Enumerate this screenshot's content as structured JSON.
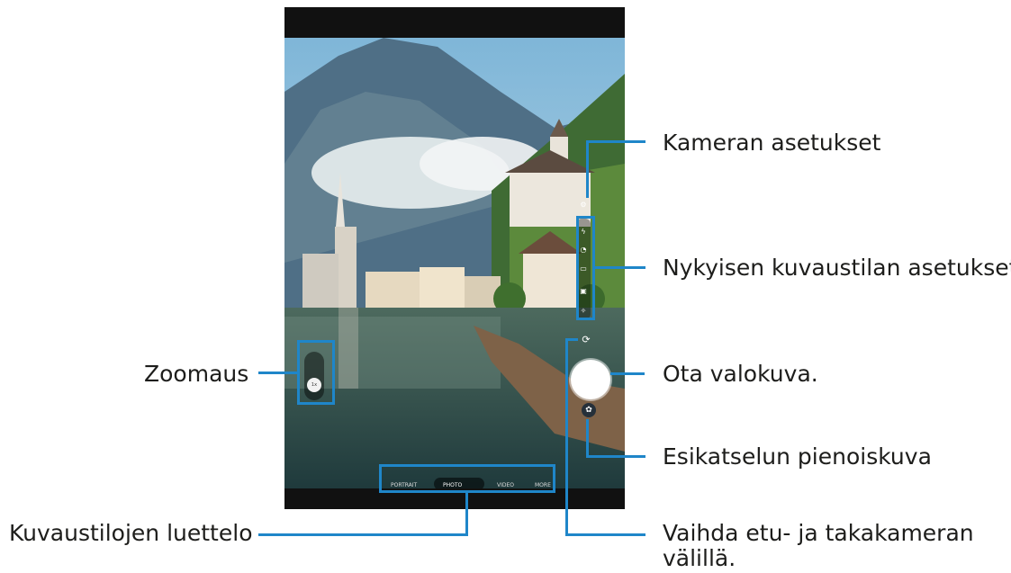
{
  "callouts": {
    "camera_settings": "Kameran asetukset",
    "mode_settings": "Nykyisen kuvaustilan asetukset",
    "zoom": "Zoomaus",
    "take_photo": "Ota valokuva.",
    "preview_thumbnail": "Esikatselun pienoiskuva",
    "mode_list": "Kuvaustilojen luettelo",
    "switch_camera_line1": "Vaihda etu- ja takakameran",
    "switch_camera_line2": "välillä."
  },
  "camera": {
    "modes": [
      "PORTRAIT",
      "PHOTO",
      "VIDEO",
      "MORE"
    ],
    "active_mode": "PHOTO",
    "zoom_value": "1x"
  },
  "colors": {
    "accent": "#1f86c9",
    "text": "#1d1d1b"
  },
  "icons": [
    "settings-icon",
    "flash-icon",
    "timer-icon",
    "ratio-icon",
    "filter-icon",
    "effects-icon",
    "switch-camera-icon",
    "shutter-button",
    "zoom-slider"
  ]
}
